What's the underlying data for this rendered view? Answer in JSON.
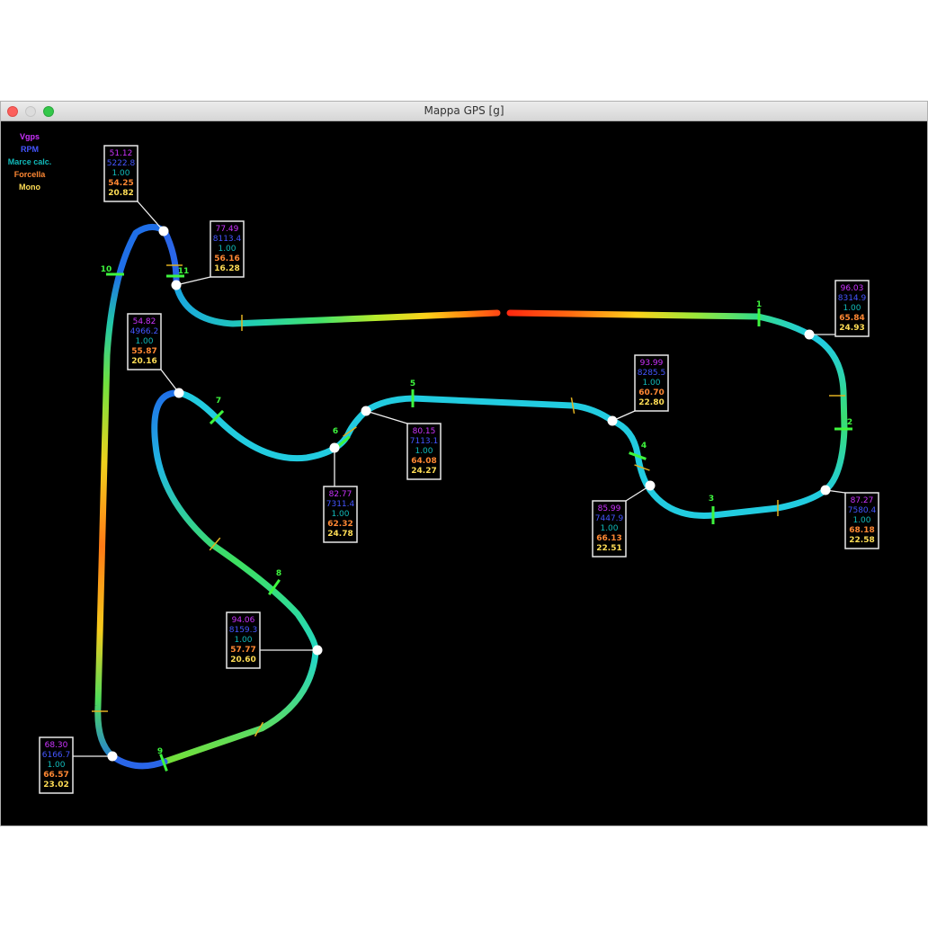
{
  "window": {
    "title": "Mappa GPS [g]"
  },
  "colors": {
    "vgps": "#cc33ff",
    "rpm": "#4455ff",
    "marce": "#11bbbb",
    "forcella": "#ff8833",
    "mono": "#ffdd55",
    "sector_mark": "#3ef53e",
    "bubble_border": "#e8e8e8",
    "point": "#ffffff"
  },
  "legend": [
    {
      "label": "Vgps",
      "color": "#cc33ff"
    },
    {
      "label": "RPM",
      "color": "#4455ff"
    },
    {
      "label": "Marce calc.",
      "color": "#11bbbb"
    },
    {
      "label": "Forcella",
      "color": "#ff8833"
    },
    {
      "label": "Mono",
      "color": "#ffdd55"
    }
  ],
  "sector_labels": [
    "1",
    "2",
    "3",
    "4",
    "5",
    "6",
    "7",
    "8",
    "9",
    "10",
    "11"
  ],
  "readouts": [
    {
      "vgps": "51.12",
      "rpm": "5222.8",
      "marce": "1.00",
      "forcella": "54.25",
      "mono": "20.82"
    },
    {
      "vgps": "77.49",
      "rpm": "8113.4",
      "marce": "1.00",
      "forcella": "56.16",
      "mono": "16.28"
    },
    {
      "vgps": "96.03",
      "rpm": "8314.9",
      "marce": "1.00",
      "forcella": "65.84",
      "mono": "24.93"
    },
    {
      "vgps": "54.82",
      "rpm": "4966.2",
      "marce": "1.00",
      "forcella": "55.87",
      "mono": "20.16"
    },
    {
      "vgps": "93.99",
      "rpm": "8285.5",
      "marce": "1.00",
      "forcella": "60.70",
      "mono": "22.80"
    },
    {
      "vgps": "80.15",
      "rpm": "7113.1",
      "marce": "1.00",
      "forcella": "64.08",
      "mono": "24.27"
    },
    {
      "vgps": "82.77",
      "rpm": "7311.4",
      "marce": "1.00",
      "forcella": "62.32",
      "mono": "24.78"
    },
    {
      "vgps": "85.99",
      "rpm": "7447.9",
      "marce": "1.00",
      "forcella": "66.13",
      "mono": "22.51"
    },
    {
      "vgps": "87.27",
      "rpm": "7580.4",
      "marce": "1.00",
      "forcella": "68.18",
      "mono": "22.58"
    },
    {
      "vgps": "94.06",
      "rpm": "8159.3",
      "marce": "1.00",
      "forcella": "57.77",
      "mono": "20.60"
    },
    {
      "vgps": "68.30",
      "rpm": "6166.7",
      "marce": "1.00",
      "forcella": "66.57",
      "mono": "23.02"
    }
  ]
}
